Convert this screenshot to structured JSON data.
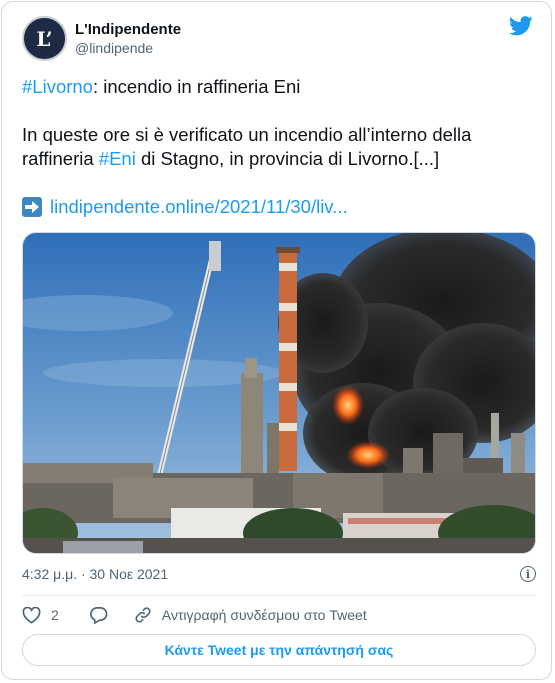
{
  "account": {
    "avatar_text": "L’",
    "display_name": "L'Indipendente",
    "handle": "@lindipende"
  },
  "tweet": {
    "line1_hashtag": "#Livorno",
    "line1_rest": ": incendio in raffineria Eni",
    "p2_part1": "In queste ore si è verificato un incendio all’interno della raffineria ",
    "p2_hashtag": "#Eni",
    "p2_part2": " di Stagno, in provincia di Livorno.[...]",
    "link_text": "lindipendente.online/2021/11/30/liv..."
  },
  "meta": {
    "timestamp": "4:32 μ.μ. · 30 Νοε 2021",
    "info_symbol": "i"
  },
  "actions": {
    "like_count": "2",
    "copy_link_label": "Αντιγραφή συνδέσμου στο Tweet"
  },
  "reply_button_label": "Κάντε Tweet με την απάντησή σας",
  "colors": {
    "accent": "#1d9bf0",
    "muted": "#536471",
    "border": "#cfd9de"
  }
}
